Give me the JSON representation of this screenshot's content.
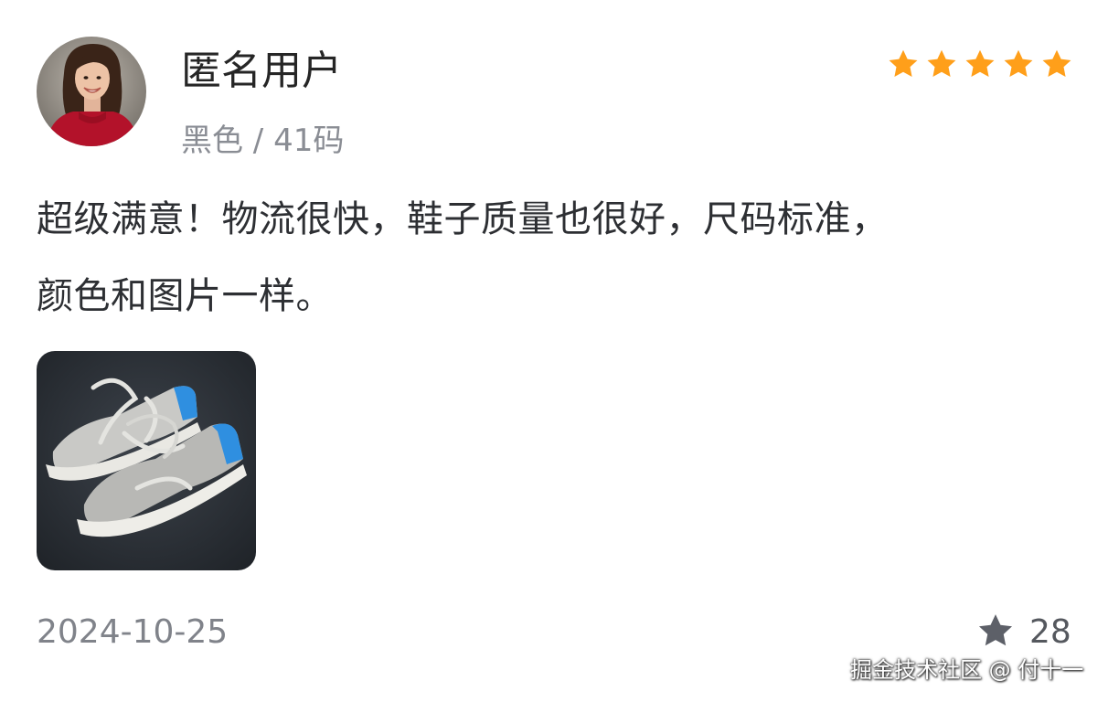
{
  "review": {
    "user_name": "匿名用户",
    "variant": "黑色 / 41码",
    "rating": 5,
    "rating_max": 5,
    "star_color": "#ff9f1a",
    "text_lines": [
      "超级满意！物流很快，鞋子质量也很好，尺码标准，",
      "颜色和图片一样。"
    ],
    "date": "2024-10-25",
    "like_count": "28",
    "like_icon": "star-icon",
    "like_icon_color": "#5d6068"
  },
  "photos": [
    {
      "icon": "sneakers-photo"
    }
  ],
  "watermark": "掘金技术社区 @ 付十一"
}
